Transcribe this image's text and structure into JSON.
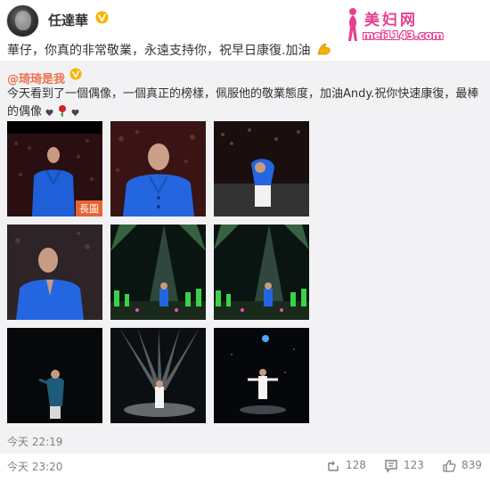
{
  "author": {
    "name": "任達華",
    "verified_badge_color": "#f7b500"
  },
  "watermark": {
    "title": "美妇网",
    "url": "mei1143.com",
    "color": "#e4408f"
  },
  "post": {
    "text": "華仔，你真的非常敬業，永遠支持你，祝早日康復.加油",
    "emoji": "flexed-biceps-icon"
  },
  "repost": {
    "author": "@琦琦是我",
    "text": "今天看到了一個偶像，一個真正的榜樣，佩服他的敬業態度，加油Andy.祝你快速康復，最棒的偶像",
    "trailing_icons": [
      "heart-icon",
      "rose-icon",
      "heart-icon"
    ],
    "long_image_tag": "長圖",
    "time": "今天 22:19",
    "images": [
      {
        "name": "photo-blue-jacket-standing",
        "scene": "blue-jacket"
      },
      {
        "name": "photo-blue-jacket-closeup",
        "scene": "blue-jacket-close"
      },
      {
        "name": "photo-bowing-on-stage",
        "scene": "bow"
      },
      {
        "name": "photo-hands-together",
        "scene": "pray"
      },
      {
        "name": "photo-stage-spotlight-1",
        "scene": "stage"
      },
      {
        "name": "photo-stage-spotlight-2",
        "scene": "stage"
      },
      {
        "name": "photo-dark-stage-figure",
        "scene": "dark"
      },
      {
        "name": "photo-spotlight-beams-white-suit",
        "scene": "beams"
      },
      {
        "name": "photo-white-suit-arms-open",
        "scene": "arms"
      }
    ]
  },
  "footer": {
    "time": "今天 23:20",
    "repost_count": "128",
    "comment_count": "123",
    "like_count": "839"
  }
}
